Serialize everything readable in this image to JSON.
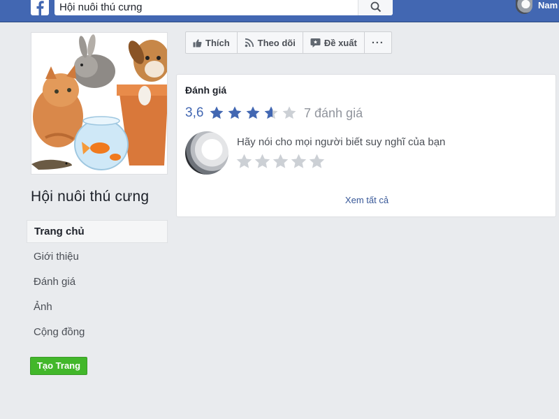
{
  "topbar": {
    "search_value": "Hội nuôi thú cưng",
    "user_name": "Nam",
    "colors": {
      "bar": "#4267b2"
    }
  },
  "page": {
    "name": "Hội nuôi thú cưng",
    "nav": {
      "home": "Trang chủ",
      "about": "Giới thiệu",
      "reviews": "Đánh giá",
      "photos": "Ảnh",
      "community": "Cộng đồng"
    },
    "create_page": "Tạo Trang"
  },
  "actions": {
    "like": "Thích",
    "follow": "Theo dõi",
    "recommend": "Đề xuất",
    "more": "···"
  },
  "reviews_card": {
    "title": "Đánh giá",
    "rating": "3,6",
    "rating_value": 3.6,
    "max_rating": 5,
    "count": "7 đánh giá",
    "prompt": "Hãy nói cho mọi người biết suy nghĩ của bạn",
    "see_all": "Xem tất cả",
    "colors": {
      "star_filled": "#4267b2",
      "star_empty": "#ccd0d5"
    }
  }
}
